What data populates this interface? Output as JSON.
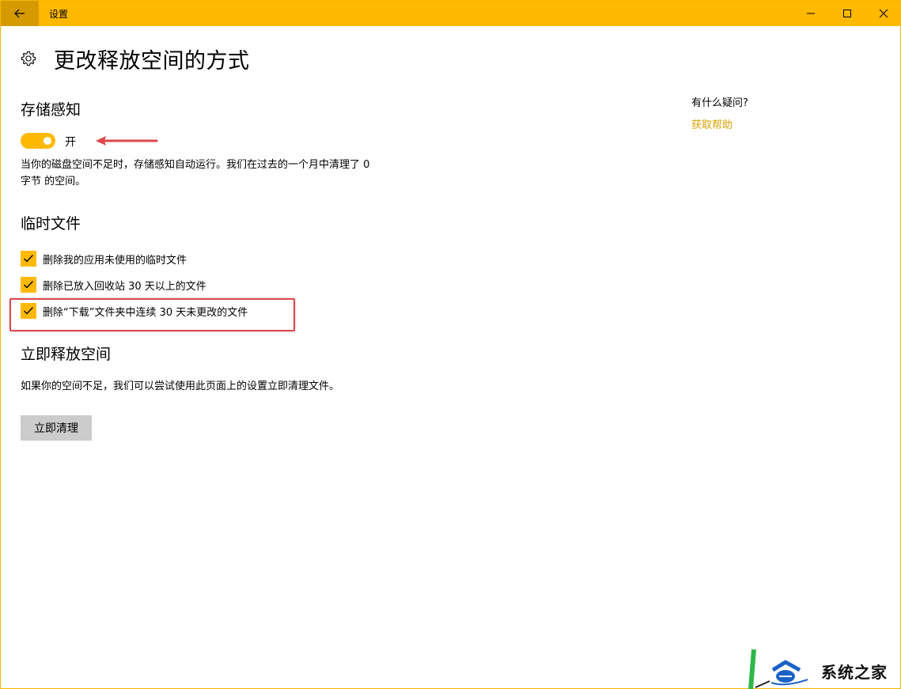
{
  "window": {
    "title": "设置",
    "back_icon": "back-arrow-icon",
    "controls": [
      "minimize-icon",
      "maximize-icon",
      "close-icon"
    ]
  },
  "header": {
    "icon": "gear-icon",
    "title": "更改释放空间的方式"
  },
  "storage_sense": {
    "heading": "存储感知",
    "toggle_state": "开",
    "toggle_on": true,
    "description": "当你的磁盘空间不足时，存储感知自动运行。我们在过去的一个月中清理了 0 字节 的空间。"
  },
  "temp_files": {
    "heading": "临时文件",
    "options": [
      {
        "label": "删除我的应用未使用的临时文件",
        "checked": true
      },
      {
        "label": "删除已放入回收站 30 天以上的文件",
        "checked": true
      },
      {
        "label": "删除“下载”文件夹中连续 30 天未更改的文件",
        "checked": true
      }
    ]
  },
  "free_now": {
    "heading": "立即释放空间",
    "description": "如果你的空间不足，我们可以尝试使用此页面上的设置立即清理文件。",
    "button_label": "立即清理"
  },
  "help": {
    "question": "有什么疑问?",
    "link": "获取帮助"
  },
  "watermark": {
    "text": "系统之家"
  },
  "colors": {
    "accent": "#ffb900",
    "accent_dark": "#d49a00",
    "link": "#d8a300",
    "annotation_red": "#e0474c",
    "button_gray": "#cccccc"
  }
}
